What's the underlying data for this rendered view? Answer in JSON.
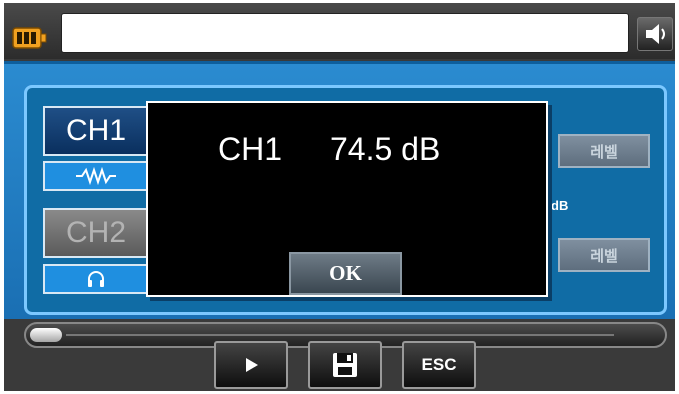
{
  "topbar": {
    "battery_icon": "battery-icon",
    "title_value": "",
    "speaker_icon": "speaker-icon"
  },
  "channels": [
    {
      "label": "CH1",
      "sub_icon": "waveform-icon",
      "active": true
    },
    {
      "label": "CH2",
      "sub_icon": "headphone-icon",
      "active": false
    }
  ],
  "level_buttons": [
    {
      "label": "레벨"
    },
    {
      "label": "레벨"
    }
  ],
  "unit_label": "dB",
  "progress": {
    "fraction": 0.05
  },
  "controls": {
    "play_icon": "play-icon",
    "save_icon": "floppy-disk-icon",
    "esc_label": "ESC"
  },
  "dialog": {
    "channel": "CH1",
    "value": "74.5 dB",
    "ok_label": "OK"
  },
  "colors": {
    "panel_blue": "#1a6fb3",
    "accent_light_blue": "#7cc8ff",
    "battery_orange": "#f0a020"
  }
}
